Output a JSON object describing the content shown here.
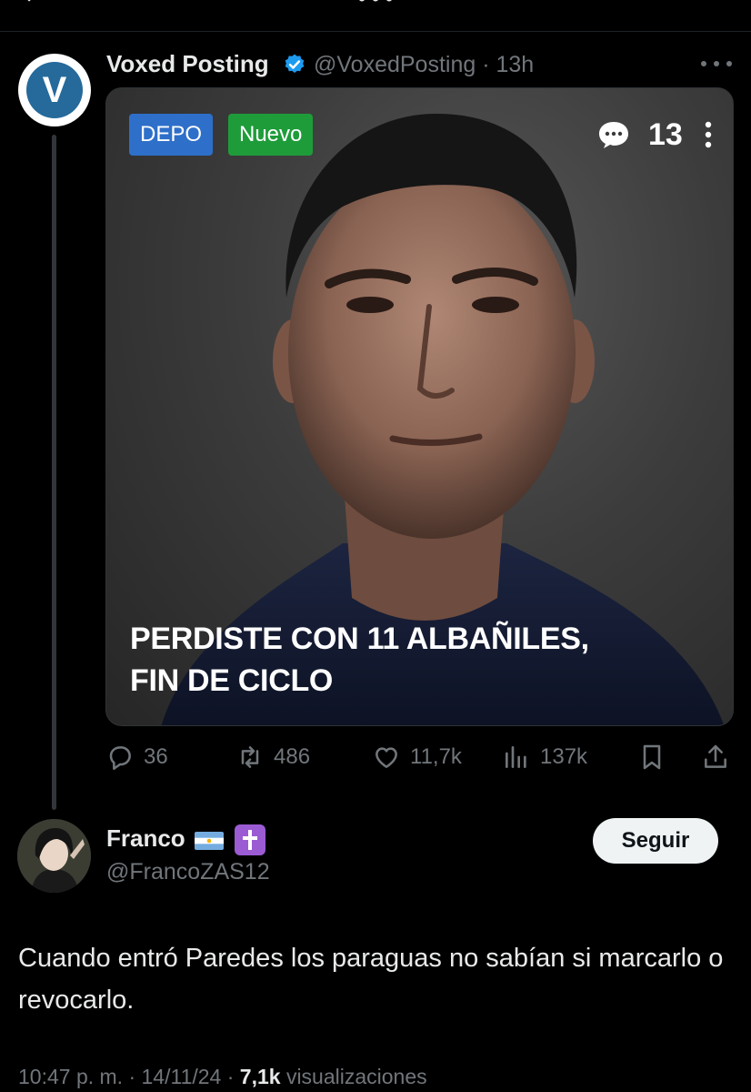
{
  "parent": {
    "avatar_letter": "V",
    "name": "Voxed Posting",
    "handle": "@VoxedPosting · 13h",
    "media": {
      "badge_1": "DEPO",
      "badge_2": "Nuevo",
      "comment_count": "13",
      "headline_line1": "PERDISTE CON 11 ALBAÑILES,",
      "headline_line2": "FIN DE CICLO"
    },
    "actions": {
      "replies": "36",
      "reposts": "486",
      "likes": "11,7k",
      "views": "137k"
    }
  },
  "reply": {
    "name": "Franco",
    "handle": "@FrancoZAS12",
    "follow_label": "Seguir",
    "text": "Cuando entró Paredes los paraguas no sabían si marcarlo o revocarlo.",
    "time": "10:47",
    "time_suffix": "p. m. · 14/11/24 ·",
    "views": "7,1k",
    "views_label": "visualizaciones"
  },
  "colors": {
    "background": "#000000",
    "text": "#e7e9ea",
    "muted": "#71767b",
    "verified": "#1d9bf0",
    "depo_badge": "#2e6fc9",
    "nuevo_badge": "#1f9c3a"
  }
}
